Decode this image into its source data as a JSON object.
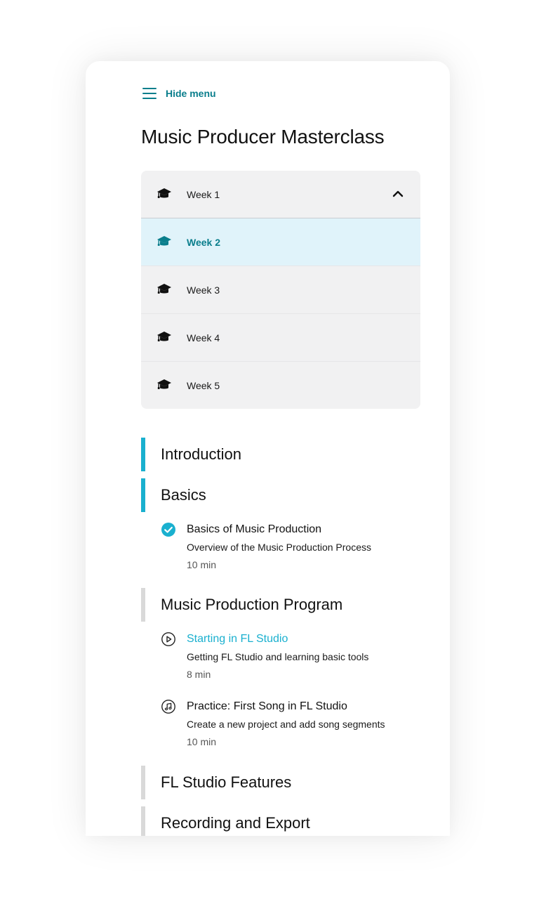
{
  "menu": {
    "hide_label": "Hide menu",
    "accent": "#0a7e8c"
  },
  "course": {
    "title": "Music Producer Masterclass"
  },
  "weeks": [
    {
      "label": "Week 1",
      "icon": "graduation-cap-icon",
      "expanded_toggle": "chevron-up-icon"
    },
    {
      "label": "Week 2",
      "icon": "graduation-cap-icon",
      "active": true
    },
    {
      "label": "Week 3",
      "icon": "graduation-cap-icon"
    },
    {
      "label": "Week 4",
      "icon": "graduation-cap-icon"
    },
    {
      "label": "Week 5",
      "icon": "graduation-cap-icon"
    }
  ],
  "sections": [
    {
      "title": "Introduction",
      "bar_color": "#1ab0cf"
    },
    {
      "title": "Basics",
      "bar_color": "#1ab0cf",
      "lessons": [
        {
          "title": "Basics of Music Production",
          "description": "Overview of the Music Production Process",
          "duration": "10 min",
          "icon": "completed-check-icon"
        }
      ]
    },
    {
      "title": "Music Production Program",
      "bar_color": "#d9d9d9",
      "lessons": [
        {
          "title": "Starting in FL Studio",
          "description": "Getting FL Studio and learning basic tools",
          "duration": "8 min",
          "icon": "play-circle-icon",
          "link_color": "#1ab0cf"
        },
        {
          "title": "Practice: First Song in FL Studio",
          "description": "Create a new project and add song segments",
          "duration": "10 min",
          "icon": "music-note-circle-icon"
        }
      ]
    },
    {
      "title": "FL Studio Features",
      "bar_color": "#d9d9d9"
    },
    {
      "title": "Recording and Export",
      "bar_color": "#d9d9d9"
    }
  ]
}
